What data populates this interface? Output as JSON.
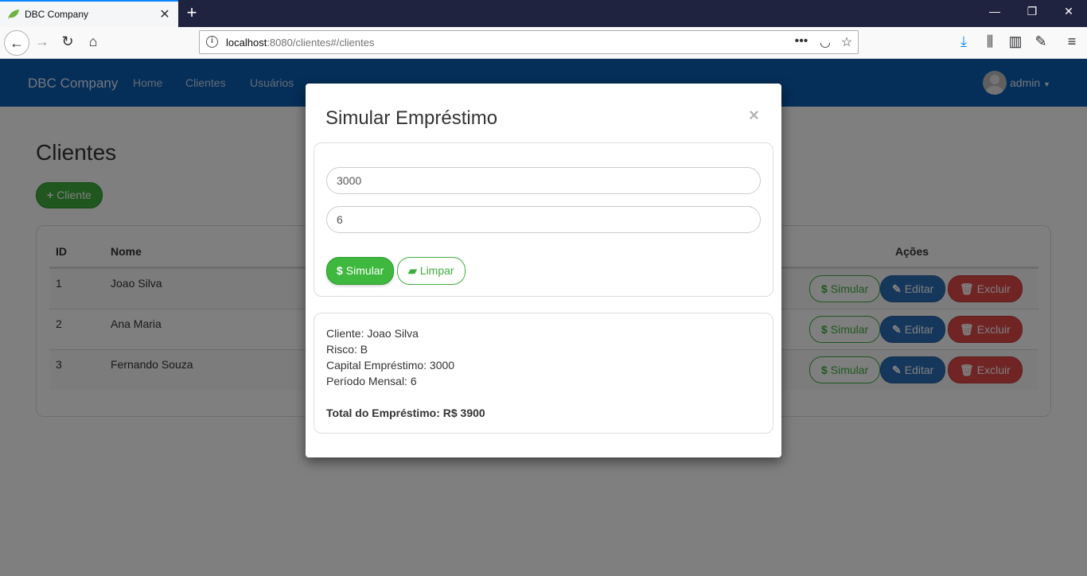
{
  "browser": {
    "tab_title": "DBC Company",
    "url_host": "localhost",
    "url_rest": ":8080/clientes#/clientes"
  },
  "app": {
    "brand": "DBC Company",
    "nav": [
      "Home",
      "Clientes",
      "Usuários"
    ],
    "user": "admin"
  },
  "page": {
    "title": "Clientes",
    "add_button": "Cliente",
    "table": {
      "headers": {
        "id": "ID",
        "name": "Nome",
        "actions": "Ações"
      },
      "rows": [
        {
          "id": "1",
          "name": "Joao Silva"
        },
        {
          "id": "2",
          "name": "Ana Maria"
        },
        {
          "id": "3",
          "name": "Fernando Souza"
        }
      ],
      "actions": {
        "simulate": "Simular",
        "edit": "Editar",
        "delete": "Excluir"
      }
    }
  },
  "modal": {
    "title": "Simular Empréstimo",
    "close": "×",
    "capital_value": "3000",
    "period_value": "6",
    "simulate_button": "Simular",
    "clear_button": "Limpar",
    "result": {
      "client": "Cliente: Joao Silva",
      "risk": "Risco: B",
      "capital": "Capital Empréstimo: 3000",
      "period": "Período Mensal: 6",
      "total": "Total do Empréstimo: R$ 3900"
    }
  },
  "colors": {
    "navbar": "#0b5cb3",
    "success": "#3fae3f",
    "primary": "#2d6fb8",
    "danger": "#e04848"
  }
}
